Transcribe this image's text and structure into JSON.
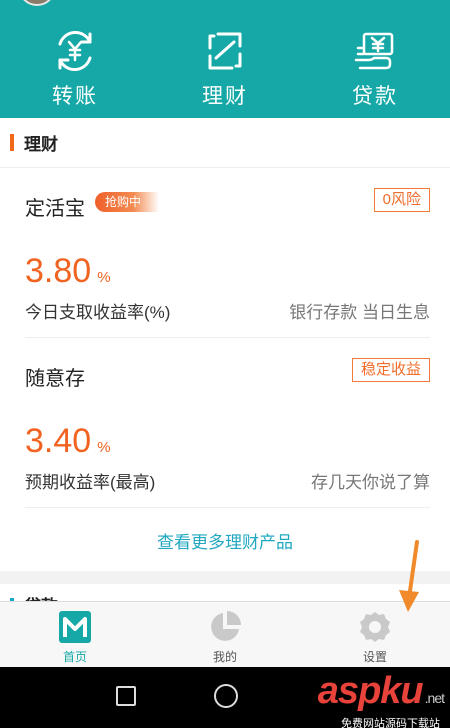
{
  "header": {
    "actions": [
      {
        "label": "转账",
        "icon": "transfer-yuan-icon"
      },
      {
        "label": "理财",
        "icon": "finance-icon"
      },
      {
        "label": "贷款",
        "icon": "loan-icon"
      }
    ]
  },
  "finance": {
    "title": "理财",
    "products": [
      {
        "name": "定活宝",
        "tag": "抢购中",
        "badge": "0风险",
        "rate": "3.80",
        "unit": "%",
        "rate_label": "今日支取收益率(%)",
        "desc": "银行存款 当日生息"
      },
      {
        "name": "随意存",
        "badge": "稳定收益",
        "rate": "3.40",
        "unit": "%",
        "rate_label": "预期收益率(最高)",
        "desc": "存几天你说了算"
      }
    ],
    "more_link": "查看更多理财产品"
  },
  "next_section": {
    "title": "贷款"
  },
  "tabbar": {
    "tabs": [
      {
        "label": "首页",
        "icon": "home-m-icon",
        "active": true
      },
      {
        "label": "我的",
        "icon": "pie-chart-icon",
        "active": false
      },
      {
        "label": "设置",
        "icon": "gear-icon",
        "active": false
      }
    ]
  },
  "watermark": {
    "main": "asp",
    "ku": "ku",
    "net": ".net",
    "sub": "免费网站源码下载站"
  },
  "colors": {
    "header": "#16a8a6",
    "accent_orange": "#f06320",
    "link_blue": "#21a7c0"
  }
}
